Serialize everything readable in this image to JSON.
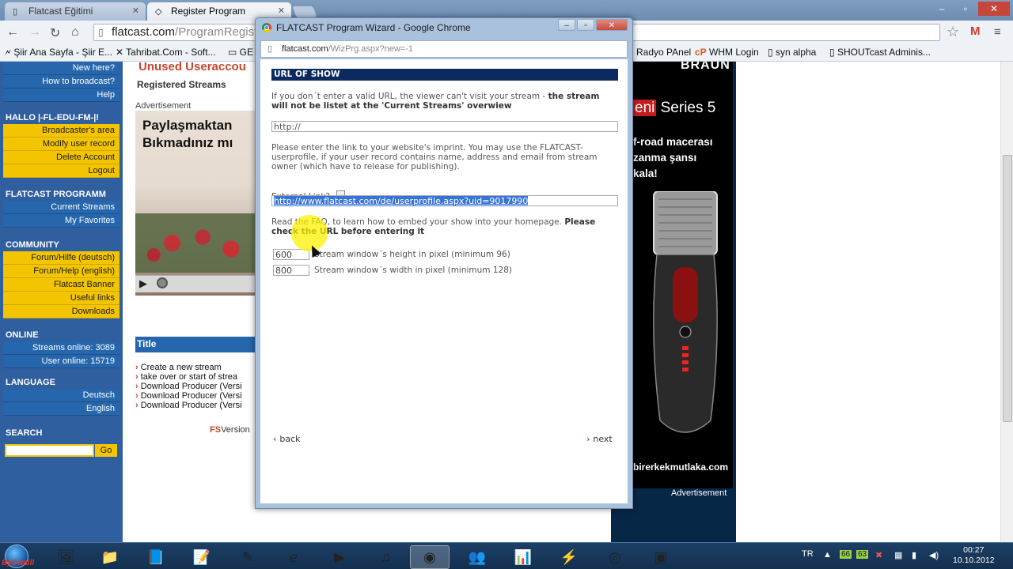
{
  "browser": {
    "tabs": [
      {
        "label": "Flatcast Eğitimi",
        "active": false
      },
      {
        "label": "Register Program",
        "active": true
      }
    ],
    "address": {
      "host": "flatcast.com",
      "path": "/ProgramRegiste"
    },
    "bookmarks": [
      "Şiir Ana Sayfa - Şiir E...",
      "Tahribat.Com - Soft...",
      "GE",
      "Radyo PAnel",
      "WHM Login",
      "syn alpha",
      "SHOUTcast Adminis..."
    ]
  },
  "page": {
    "leftnav": {
      "top_links": [
        "New here?",
        "How to broadcast?",
        "Help"
      ],
      "user_heading": "HALLO |-FL-EDU-FM-|!",
      "user_links": [
        "Broadcaster's area",
        "Modify user record",
        "Delete Account",
        "Logout"
      ],
      "program_heading": "FLATCAST PROGRAMM",
      "program_links": [
        "Current Streams",
        "My Favorites"
      ],
      "community_heading": "COMMUNITY",
      "community_links": [
        "Forum/Hilfe (deutsch)",
        "Forum/Help (english)",
        "Flatcast Banner",
        "Useful links",
        "Downloads"
      ],
      "online_heading": "ONLINE",
      "online_stats": [
        "Streams online: 3089",
        "User online: 15719"
      ],
      "language_heading": "LANGUAGE",
      "language_links": [
        "Deutsch",
        "English"
      ],
      "search_heading": "SEARCH",
      "search_button": "Go"
    },
    "main": {
      "unused_heading": "Unused Useraccou",
      "registered_streams": "Registered Streams",
      "advertisement_label": "Advertisement",
      "ad_text_line1": "Paylaşmaktan",
      "ad_text_line2": "Bıkmadınız mı",
      "title_header": "Title",
      "title_list": [
        "Create a new stream",
        "take over or start of strea",
        "Download Producer (Versi",
        "Download Producer (Versi",
        "Download Producer (Versi"
      ],
      "fs_badge": "FS",
      "version_text": "Version"
    },
    "right_ad": {
      "brand": "BRAUN",
      "series_prefix": "eni",
      "series_rest": " Series 5",
      "promo_lines": [
        "f-road macerası",
        "zanma şansı",
        "kala!"
      ],
      "url": "birerkekmutlaka.com",
      "label": "Advertisement"
    }
  },
  "popup": {
    "title": "FLATCAST Program Wizard - Google Chrome",
    "address": {
      "host": "flatcast.com",
      "path": "/WizPrg.aspx?new=-1"
    },
    "section_title": "URL OF SHOW",
    "intro_text": "If you don´t enter a valid URL, the viewer can't visit your stream - ",
    "intro_bold": "the stream will not be listet at the 'Current Streams' overwiew",
    "url_value": "http://",
    "imprint_text": "Please enter the link to your website's imprint. You may use the FLATCAST-userprofile, if your user record contains name, address and email from stream owner (which have to release for publishing).",
    "external_link_label": "External Link?",
    "external_link_checked": false,
    "profile_url_value": "http://www.flatcast.com/de/userprofile.aspx?uid=9017990",
    "faq_text": "Read the FAQ, to learn how to embed your show into your homepage. ",
    "faq_bold": "Please check the URL before entering it",
    "height_value": "600",
    "height_label": "Stream window´s height in pixel (minimum 96)",
    "width_value": "800",
    "width_label": "Stream window´s width in pixel (minimum 128)",
    "back_label": "back",
    "next_label": "next"
  },
  "taskbar": {
    "watermark": "BySwaill",
    "language": "TR",
    "tray_numbers": [
      "66",
      "63"
    ],
    "time": "00:27",
    "date": "10.10.2012"
  },
  "colors": {
    "nav_blue": "#2566ac",
    "nav_yellow": "#f3c500",
    "section_navy": "#0b2a60",
    "selection_blue": "#3874d8",
    "cursor_highlight": "#fff000"
  }
}
